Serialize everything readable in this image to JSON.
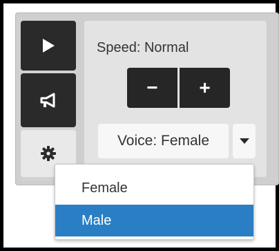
{
  "accent_color": "#2a7fc4",
  "sidebar": {
    "buttons": [
      {
        "icon": "play-icon"
      },
      {
        "icon": "megaphone-icon"
      },
      {
        "icon": "gear-icon"
      }
    ]
  },
  "settings": {
    "speed_label": "Speed: Normal",
    "decrease_label": "−",
    "increase_label": "+",
    "voice_selected": "Voice: Female"
  },
  "dropdown": {
    "options": [
      {
        "label": "Female",
        "selected": false
      },
      {
        "label": "Male",
        "selected": true
      }
    ]
  }
}
